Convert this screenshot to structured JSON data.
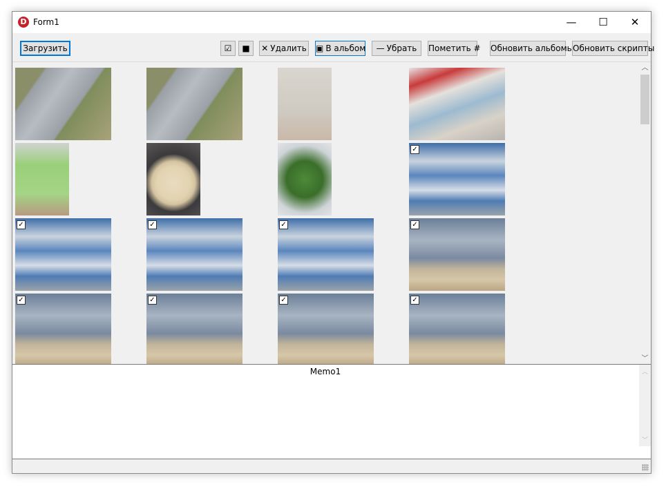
{
  "window": {
    "title": "Form1",
    "app_icon_letter": "D",
    "controls": {
      "minimize": "—",
      "maximize": "☐",
      "close": "✕"
    }
  },
  "toolbar": {
    "load": "Загрузить",
    "check_all": "☑",
    "check_none": "■",
    "delete": "Удалить",
    "delete_icon": "✕",
    "to_album": "В альбом",
    "to_album_icon": "▣",
    "remove": "Убрать",
    "remove_icon": "—",
    "mark": "Пометить #",
    "update_albums": "Обновить альбомы",
    "update_scripts": "Обновить скрипты"
  },
  "thumbnails": [
    {
      "kind": "road",
      "checked": false
    },
    {
      "kind": "road",
      "checked": false
    },
    {
      "kind": "thermo",
      "checked": false
    },
    {
      "kind": "table",
      "checked": false
    },
    {
      "kind": "note",
      "checked": false
    },
    {
      "kind": "food",
      "checked": false
    },
    {
      "kind": "plant",
      "checked": false
    },
    {
      "kind": "sky",
      "checked": true
    },
    {
      "kind": "sky",
      "checked": true
    },
    {
      "kind": "sky",
      "checked": true
    },
    {
      "kind": "sky",
      "checked": true
    },
    {
      "kind": "city",
      "checked": true
    },
    {
      "kind": "city",
      "checked": true
    },
    {
      "kind": "city",
      "checked": true
    },
    {
      "kind": "city",
      "checked": true
    },
    {
      "kind": "city",
      "checked": true
    }
  ],
  "memo": {
    "text": "Memo1"
  },
  "colors": {
    "accent": "#0078d7",
    "app_icon": "#c4232b"
  }
}
